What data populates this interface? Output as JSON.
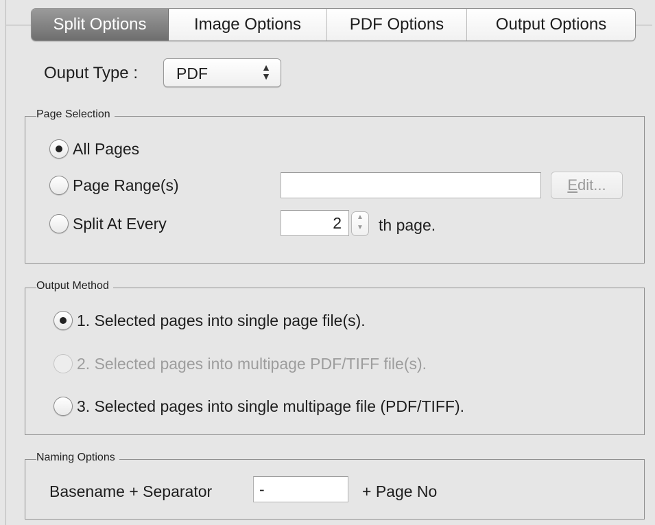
{
  "tabs": [
    {
      "label": "Split Options",
      "active": true
    },
    {
      "label": "Image Options",
      "active": false
    },
    {
      "label": "PDF Options",
      "active": false
    },
    {
      "label": "Output Options",
      "active": false
    }
  ],
  "output_type": {
    "label": "Ouput Type :",
    "selected": "PDF",
    "arrows": "⬍"
  },
  "page_selection": {
    "title": "Page Selection",
    "options": [
      {
        "label": "All Pages",
        "selected": true
      },
      {
        "label": "Page Range(s)",
        "selected": false
      },
      {
        "label": "Split At Every",
        "selected": false
      }
    ],
    "range_value": "",
    "edit_label": "Edit...",
    "every_value": "2",
    "every_suffix": "th page."
  },
  "output_method": {
    "title": "Output Method",
    "options": [
      {
        "label": "1. Selected pages into single page file(s).",
        "selected": true,
        "disabled": false
      },
      {
        "label": "2. Selected pages into multipage PDF/TIFF file(s).",
        "selected": false,
        "disabled": true
      },
      {
        "label": "3. Selected pages into single multipage file (PDF/TIFF).",
        "selected": false,
        "disabled": false
      }
    ]
  },
  "naming_options": {
    "title": "Naming Options",
    "prefix": "Basename + Separator",
    "separator_value": "-",
    "suffix": "+ Page No"
  },
  "colors": {
    "background": "#e6e6e6",
    "active_tab": "#7c7c7c",
    "disabled_text": "#9d9d9d"
  }
}
